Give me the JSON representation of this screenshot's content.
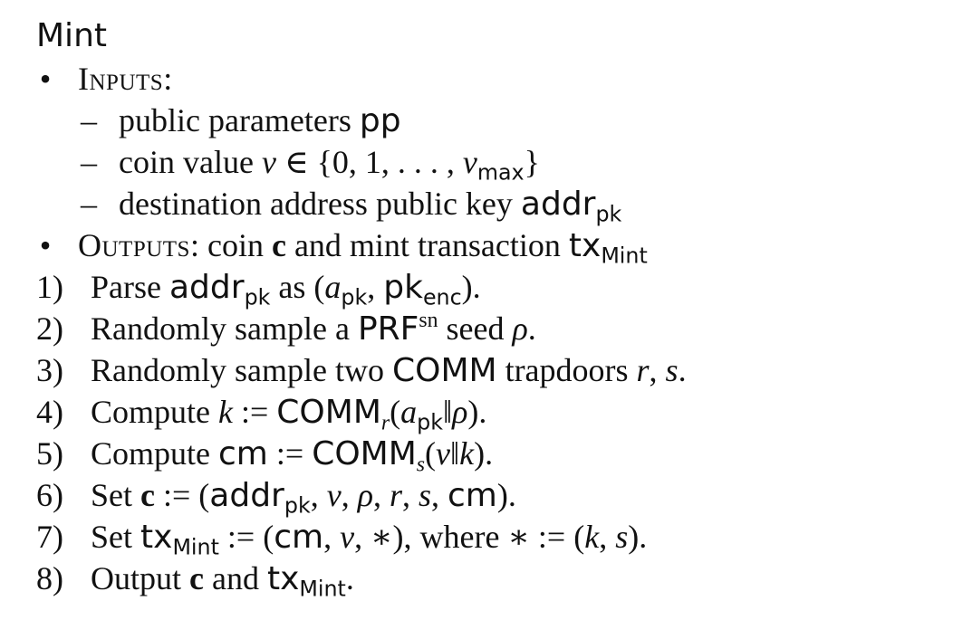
{
  "algorithm": {
    "title": "Mint",
    "inputs_label": "Inputs",
    "inputs": [
      "public parameters pp",
      "coin value v ∈ {0, 1, . . . , v_max}",
      "destination address public key addr_pk"
    ],
    "outputs_label": "Outputs",
    "outputs_text": "coin c and mint transaction tx_Mint",
    "steps": [
      {
        "num": "1)",
        "text": "Parse addr_pk as (a_pk, pk_enc)."
      },
      {
        "num": "2)",
        "text": "Randomly sample a PRF^sn seed ρ."
      },
      {
        "num": "3)",
        "text": "Randomly sample two COMM trapdoors r, s."
      },
      {
        "num": "4)",
        "text": "Compute k := COMM_r(a_pk‖ρ)."
      },
      {
        "num": "5)",
        "text": "Compute cm := COMM_s(v‖k)."
      },
      {
        "num": "6)",
        "text": "Set c := (addr_pk, v, ρ, r, s, cm)."
      },
      {
        "num": "7)",
        "text": "Set tx_Mint := (cm, v, ∗), where ∗ := (k, s)."
      },
      {
        "num": "8)",
        "text": "Output c and tx_Mint."
      }
    ]
  }
}
